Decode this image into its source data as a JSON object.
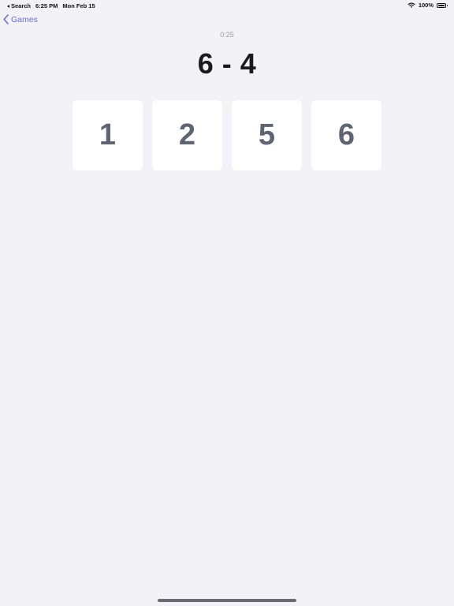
{
  "status_bar": {
    "back_app": "Search",
    "time": "6:25 PM",
    "date": "Mon Feb 15",
    "battery": "100%"
  },
  "nav": {
    "back_label": "Games"
  },
  "game": {
    "timer": "0:25",
    "problem": "6 - 4",
    "answers": [
      "1",
      "2",
      "5",
      "6"
    ]
  },
  "colors": {
    "background": "#f2f2f7",
    "accent": "#6a6fd8",
    "tile": "#ffffff",
    "tile_text": "#5d6472"
  }
}
